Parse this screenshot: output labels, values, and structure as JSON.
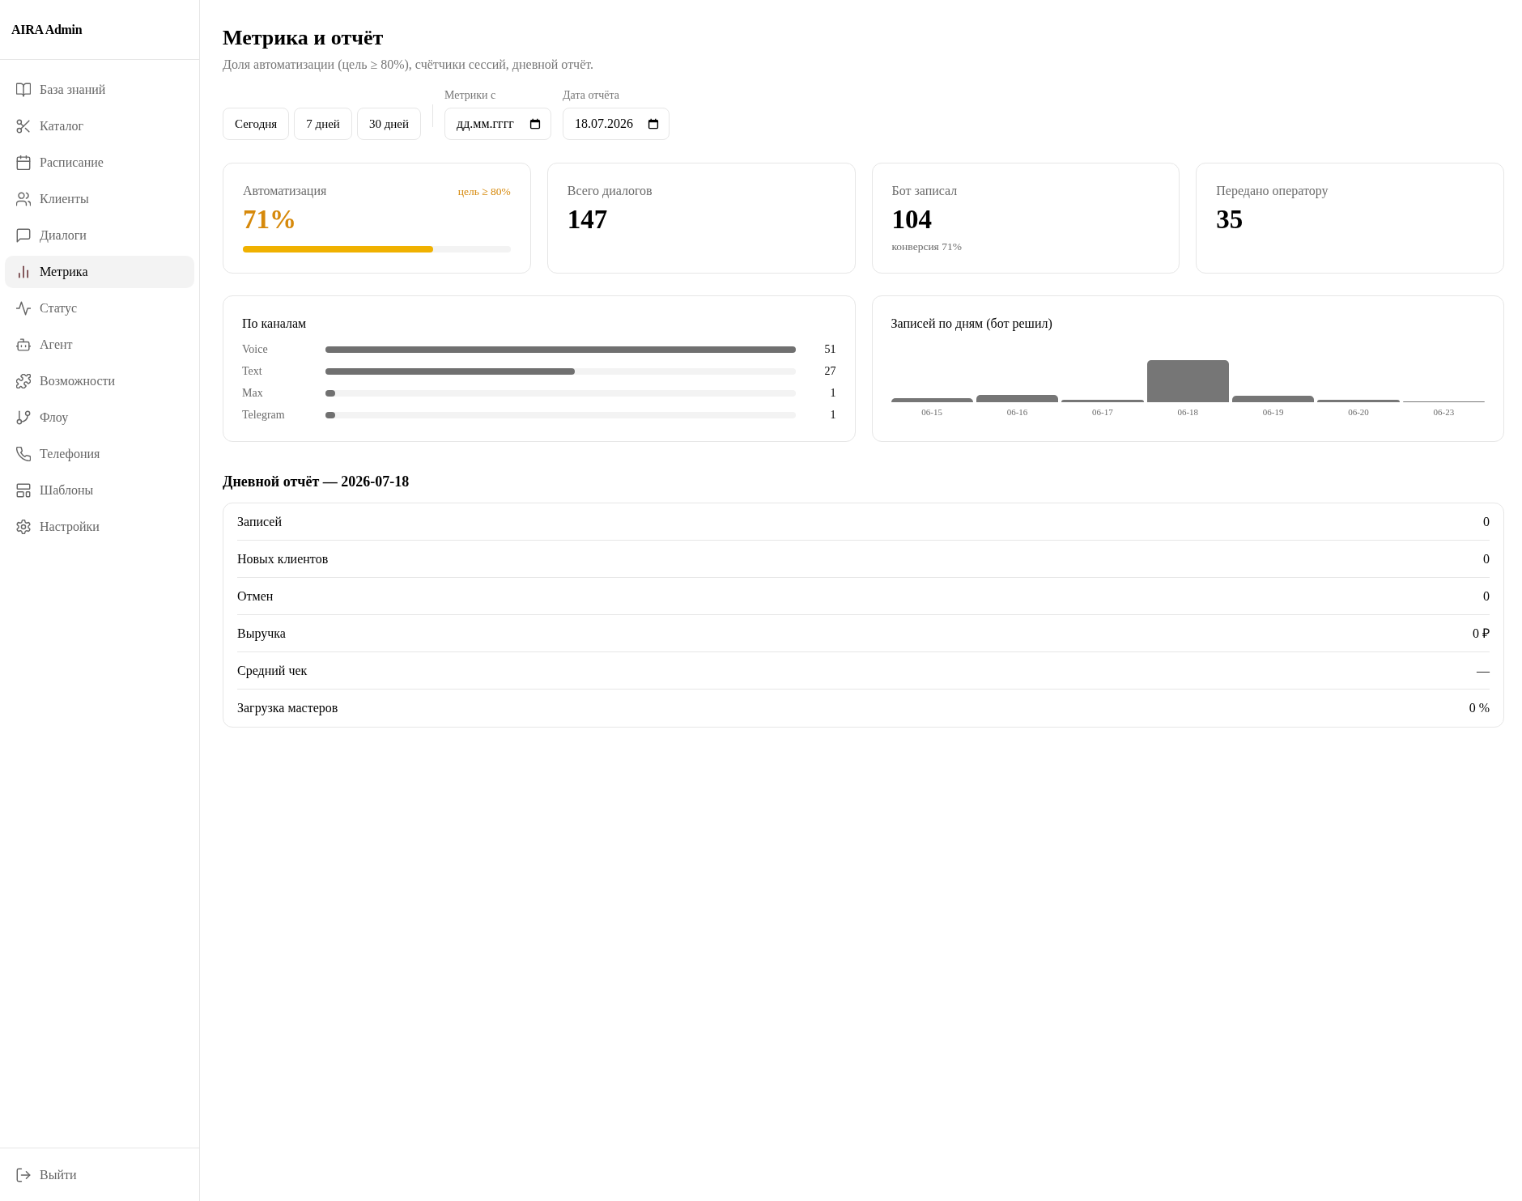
{
  "sidebar": {
    "logo": "AIRA Admin",
    "items": [
      {
        "label": "База знаний",
        "selected": false
      },
      {
        "label": "Каталог",
        "selected": false
      },
      {
        "label": "Расписание",
        "selected": false
      },
      {
        "label": "Клиенты",
        "selected": false
      },
      {
        "label": "Диалоги",
        "selected": false
      },
      {
        "label": "Метрика",
        "selected": true
      },
      {
        "label": "Статус",
        "selected": false
      },
      {
        "label": "Агент",
        "selected": false
      },
      {
        "label": "Возможности",
        "selected": false
      },
      {
        "label": "Флоу",
        "selected": false
      },
      {
        "label": "Телефония",
        "selected": false
      },
      {
        "label": "Шаблоны",
        "selected": false
      },
      {
        "label": "Настройки",
        "selected": false
      }
    ],
    "logout": "Выйти"
  },
  "header": {
    "title": "Метрика и отчёт",
    "subtitle": "Доля автоматизации (цель ≥ 80%), счётчики сессий, дневной отчёт."
  },
  "filters": {
    "ranges": [
      {
        "label": "Сегодня",
        "selected": false
      },
      {
        "label": "7 дней",
        "selected": false
      },
      {
        "label": "30 дней",
        "selected": false
      }
    ],
    "fields": [
      {
        "label": "Метрики с",
        "placeholder": "дд.мм.гггг"
      },
      {
        "label": "Дата отчёта",
        "value": "18.07.2026"
      }
    ]
  },
  "kpis": [
    {
      "kind": "goal",
      "label": "Автоматизация",
      "goal": "цель ≥ 80%",
      "value": "71%",
      "level": 0.71
    },
    {
      "kind": "count",
      "label": "Всего диалогов",
      "value": "147"
    },
    {
      "kind": "count",
      "label": "Бот записал",
      "value": "104",
      "note": "конверсия 71%"
    },
    {
      "kind": "count",
      "label": "Передано оператору",
      "value": "35"
    }
  ],
  "channels": {
    "title": "По каналам",
    "rows": [
      {
        "name": "Voice",
        "level": 1,
        "count": "51"
      },
      {
        "name": "Text",
        "level": 0.53,
        "count": "27"
      },
      {
        "name": "Max",
        "level": 0.02,
        "count": "1"
      },
      {
        "name": "Telegram",
        "level": 0.02,
        "count": "1"
      }
    ]
  },
  "daily_chart": {
    "title": "Записей по дням (бот решил)",
    "days": [
      "06-15",
      "06-16",
      "06-17",
      "06-18",
      "06-19",
      "06-20",
      "06-23"
    ]
  },
  "daily_report": {
    "title": "Дневной отчёт — 2026-07-18",
    "rows": [
      {
        "label": "Записей",
        "value": "0"
      },
      {
        "label": "Новых клиентов",
        "value": "0"
      },
      {
        "label": "Отмен",
        "value": "0"
      },
      {
        "label": "Выручка",
        "value": "0 ₽"
      },
      {
        "label": "Средний чек",
        "value": "—"
      },
      {
        "label": "Загрузка мастеров",
        "value": "0 %"
      }
    ]
  }
}
